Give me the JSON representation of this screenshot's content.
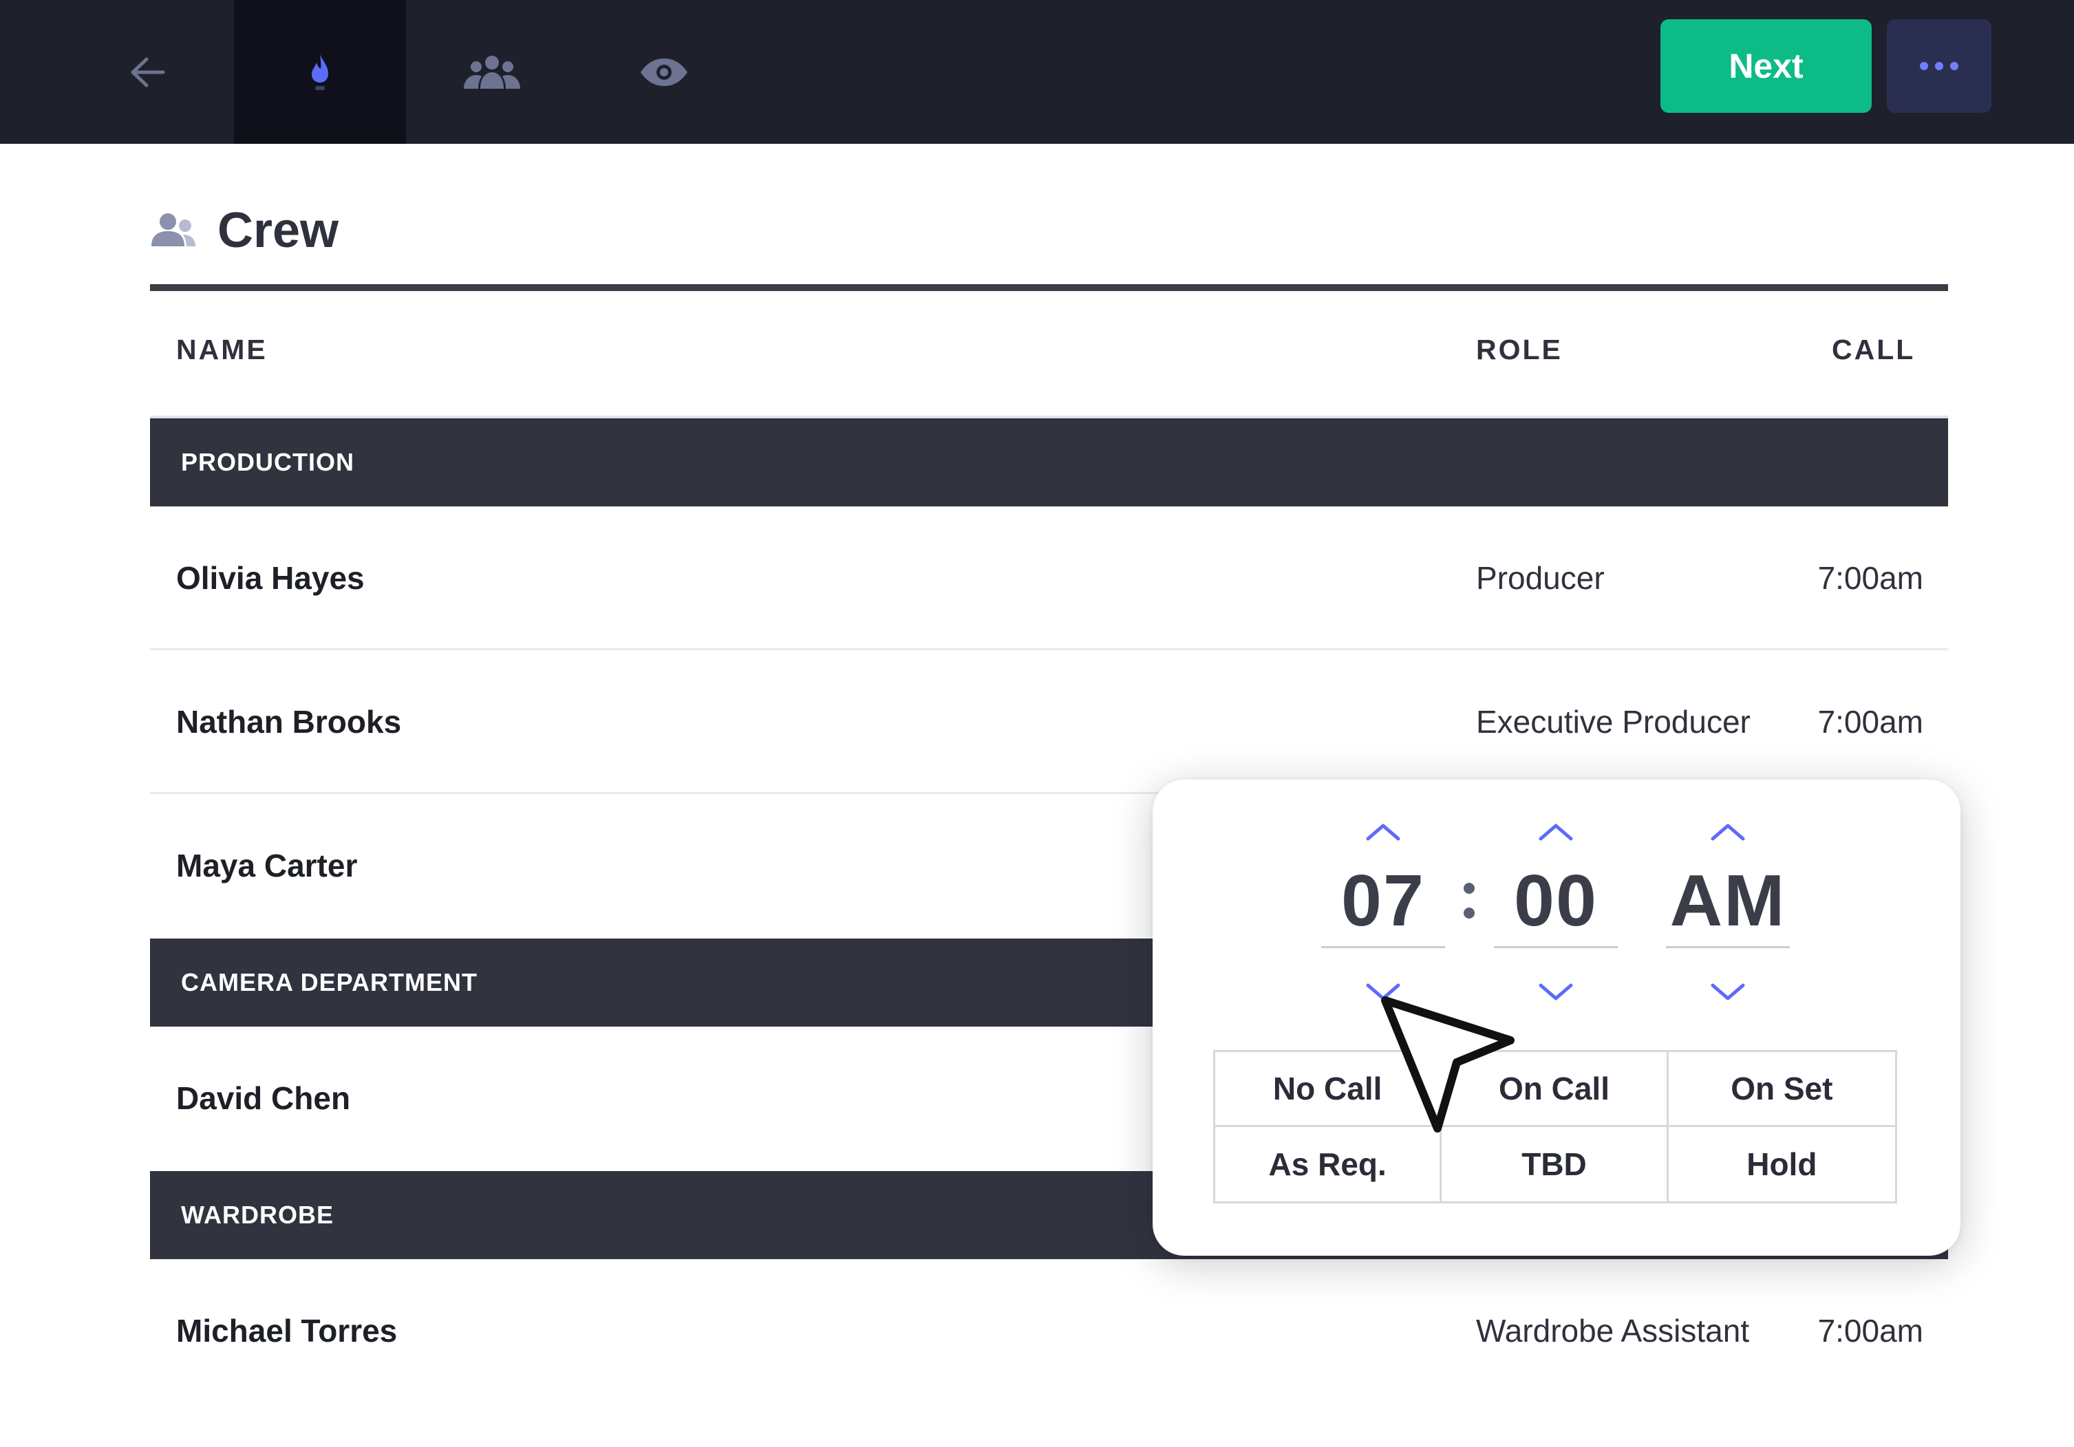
{
  "toolbar": {
    "nav": [
      {
        "icon": "back-arrow-icon",
        "active": false
      },
      {
        "icon": "flame-icon",
        "active": true
      },
      {
        "icon": "team-icon",
        "active": false
      },
      {
        "icon": "eye-icon",
        "active": false
      }
    ],
    "next_label": "Next",
    "more_icon": "ellipsis-icon"
  },
  "section": {
    "icon": "people-icon",
    "title": "Crew"
  },
  "table": {
    "headers": {
      "name": "NAME",
      "role": "ROLE",
      "call": "CALL"
    },
    "groups": [
      {
        "label": "PRODUCTION",
        "rows": [
          {
            "name": "Olivia Hayes",
            "role": "Producer",
            "call": "7:00am"
          },
          {
            "name": "Nathan Brooks",
            "role": "Executive Producer",
            "call": "7:00am"
          },
          {
            "name": "Maya Carter",
            "role": "",
            "call": ""
          }
        ]
      },
      {
        "label": "CAMERA DEPARTMENT",
        "rows": [
          {
            "name": "David Chen",
            "role": "",
            "call": ""
          }
        ]
      },
      {
        "label": "WARDROBE",
        "rows": [
          {
            "name": "Michael Torres",
            "role": "Wardrobe Assistant",
            "call": "7:00am"
          }
        ]
      }
    ]
  },
  "time_picker": {
    "hour": "07",
    "separator": ":",
    "minute": "00",
    "period": "AM",
    "options": [
      "No Call",
      "On Call",
      "On Set",
      "As Req.",
      "TBD",
      "Hold"
    ]
  },
  "colors": {
    "topbar": "#1e202c",
    "active_tab": "#0f1019",
    "next_button": "#0dbb86",
    "more_button": "#2a2f52",
    "accent_blue": "#5b6cf9",
    "group_bar": "#31333f"
  }
}
